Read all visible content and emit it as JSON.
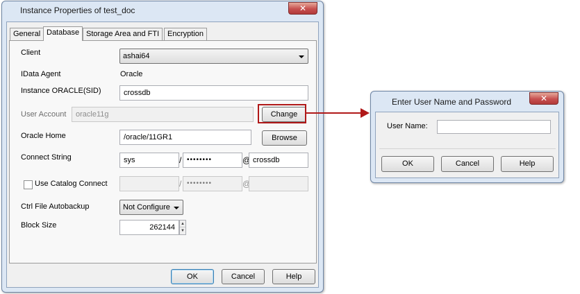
{
  "main_dialog": {
    "title": "Instance Properties of test_doc",
    "close_symbol": "✕",
    "tabs": [
      {
        "label": "General"
      },
      {
        "label": "Database"
      },
      {
        "label": "Storage Area and FTI"
      },
      {
        "label": "Encryption"
      }
    ],
    "active_tab": "Database",
    "client_label": "Client",
    "client_value": "ashai64",
    "idata_agent_label": "IData Agent",
    "idata_agent_value": "Oracle",
    "instance_label": "Instance ORACLE(SID)",
    "instance_value": "crossdb",
    "user_account_label": "User Account",
    "user_account_value": "oracle11g",
    "change_label": "Change",
    "oracle_home_label": "Oracle Home",
    "oracle_home_value": "/oracle/11GR1",
    "browse_label": "Browse",
    "connect_string_label": "Connect String",
    "connect_user": "sys",
    "connect_password": "••••••••",
    "connect_db": "crossdb",
    "slash": "/",
    "at": "@",
    "use_catalog_label": "Use Catalog Connect",
    "catalog_user": "",
    "catalog_password": "••••••••",
    "catalog_db": "",
    "ctrl_file_label": "Ctrl File Autobackup",
    "ctrl_file_value": "Not Configure",
    "block_size_label": "Block Size",
    "block_size_value": "262144",
    "spin_up": "▲",
    "spin_down": "▼",
    "ok_label": "OK",
    "cancel_label": "Cancel",
    "help_label": "Help"
  },
  "login_dialog": {
    "title": "Enter User Name and Password",
    "close_symbol": "✕",
    "user_name_label": "User Name:",
    "user_name_value": "",
    "ok_label": "OK",
    "cancel_label": "Cancel",
    "help_label": "Help"
  },
  "colors": {
    "dialog_frame": "#dce7f4",
    "highlight": "#b01818",
    "close_button": "#c75050"
  },
  "icons": {
    "close": "close-icon",
    "dropdown": "chevron-down-icon",
    "connector": "arrow-right-icon"
  }
}
